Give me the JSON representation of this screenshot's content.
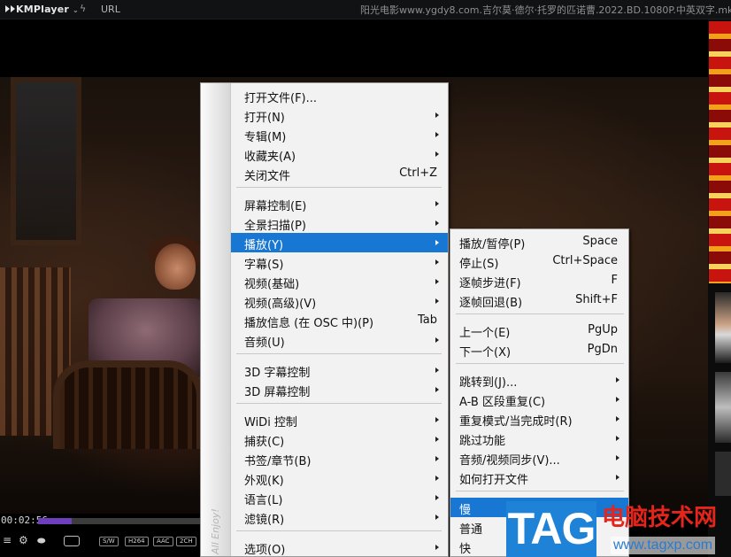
{
  "titlebar": {
    "app_name": "KMPlayer",
    "url_label": "URL",
    "file_title": "阳光电影www.ygdy8.com.吉尔莫·德尔·托罗的匹诺曹.2022.BD.1080P.中英双字.mkv"
  },
  "player": {
    "current_time": "00:02:56",
    "progress_fraction": 0.21,
    "badges": [
      "S/W",
      "H264",
      "AAC",
      "2CH"
    ]
  },
  "menu": {
    "gutter_text": "All Enjoy!",
    "items": [
      {
        "label": "打开文件(F)...",
        "shortcut": "",
        "submenu": false
      },
      {
        "label": "打开(N)",
        "shortcut": "",
        "submenu": true
      },
      {
        "label": "专辑(M)",
        "shortcut": "",
        "submenu": true
      },
      {
        "label": "收藏夹(A)",
        "shortcut": "",
        "submenu": true
      },
      {
        "label": "关闭文件",
        "shortcut": "Ctrl+Z",
        "submenu": false
      },
      {
        "label": "屏幕控制(E)",
        "shortcut": "",
        "submenu": true
      },
      {
        "label": "全景扫描(P)",
        "shortcut": "",
        "submenu": true
      },
      {
        "label": "播放(Y)",
        "shortcut": "",
        "submenu": true
      },
      {
        "label": "字幕(S)",
        "shortcut": "",
        "submenu": true
      },
      {
        "label": "视频(基础)",
        "shortcut": "",
        "submenu": true
      },
      {
        "label": "视频(高级)(V)",
        "shortcut": "",
        "submenu": true
      },
      {
        "label": "播放信息 (在 OSC 中)(P)",
        "shortcut": "Tab",
        "submenu": false
      },
      {
        "label": "音频(U)",
        "shortcut": "",
        "submenu": true
      },
      {
        "label": "3D 字幕控制",
        "shortcut": "",
        "submenu": true
      },
      {
        "label": "3D 屏幕控制",
        "shortcut": "",
        "submenu": true
      },
      {
        "label": "WiDi 控制",
        "shortcut": "",
        "submenu": true
      },
      {
        "label": "捕获(C)",
        "shortcut": "",
        "submenu": true
      },
      {
        "label": "书签/章节(B)",
        "shortcut": "",
        "submenu": true
      },
      {
        "label": "外观(K)",
        "shortcut": "",
        "submenu": true
      },
      {
        "label": "语言(L)",
        "shortcut": "",
        "submenu": true
      },
      {
        "label": "滤镜(R)",
        "shortcut": "",
        "submenu": true
      },
      {
        "label": "选项(O)",
        "shortcut": "",
        "submenu": true
      }
    ]
  },
  "submenu": {
    "items": [
      {
        "label": "播放/暂停(P)",
        "shortcut": "Space",
        "submenu": false
      },
      {
        "label": "停止(S)",
        "shortcut": "Ctrl+Space",
        "submenu": false
      },
      {
        "label": "逐帧步进(F)",
        "shortcut": "F",
        "submenu": false
      },
      {
        "label": "逐帧回退(B)",
        "shortcut": "Shift+F",
        "submenu": false
      },
      {
        "label": "上一个(E)",
        "shortcut": "PgUp",
        "submenu": false
      },
      {
        "label": "下一个(X)",
        "shortcut": "PgDn",
        "submenu": false
      },
      {
        "label": "跳转到(J)...",
        "shortcut": "",
        "submenu": true
      },
      {
        "label": "A-B 区段重复(C)",
        "shortcut": "",
        "submenu": true
      },
      {
        "label": "重复模式/当完成时(R)",
        "shortcut": "",
        "submenu": true
      },
      {
        "label": "跳过功能",
        "shortcut": "",
        "submenu": true
      },
      {
        "label": "音频/视频同步(V)...",
        "shortcut": "",
        "submenu": true
      },
      {
        "label": "如何打开文件",
        "shortcut": "",
        "submenu": true
      },
      {
        "label": "慢",
        "shortcut": "",
        "submenu": false
      },
      {
        "label": "普通",
        "shortcut": "",
        "submenu": false
      },
      {
        "label": "快",
        "shortcut": "",
        "submenu": false
      }
    ]
  },
  "watermark": {
    "tag": "TAG",
    "site_name": "电脑技术网",
    "site_url": "www.tagxp.com"
  }
}
